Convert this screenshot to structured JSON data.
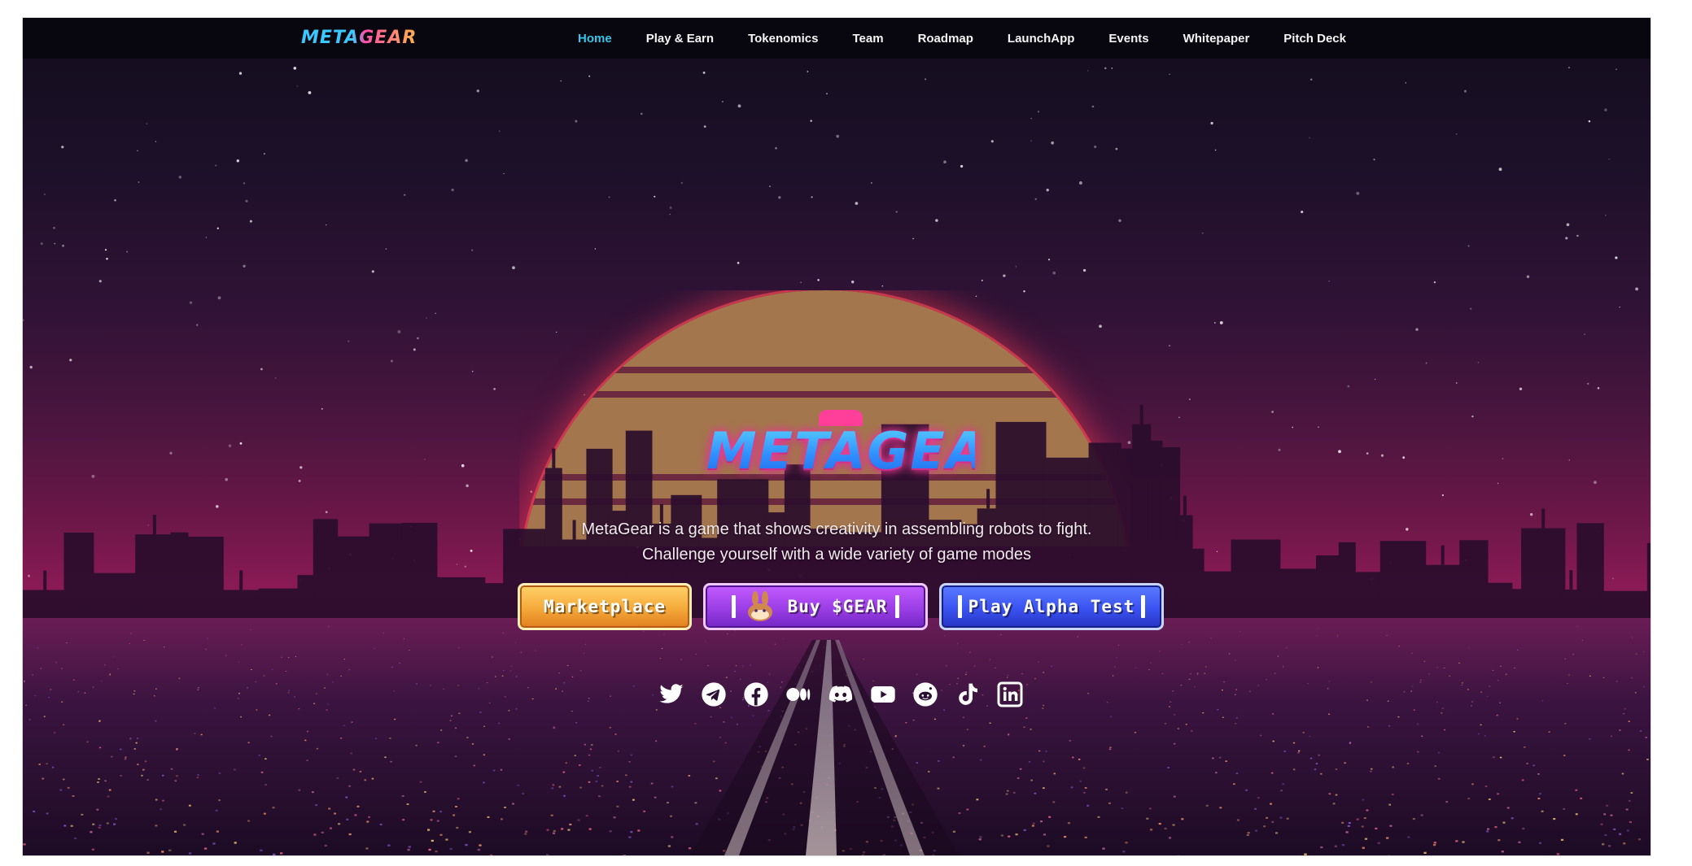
{
  "brand": {
    "name": "METAGEAR"
  },
  "nav": {
    "items": [
      {
        "label": "Home",
        "active": true
      },
      {
        "label": "Play & Earn",
        "active": false
      },
      {
        "label": "Tokenomics",
        "active": false
      },
      {
        "label": "Team",
        "active": false
      },
      {
        "label": "Roadmap",
        "active": false
      },
      {
        "label": "LaunchApp",
        "active": false
      },
      {
        "label": "Events",
        "active": false
      },
      {
        "label": "Whitepaper",
        "active": false
      },
      {
        "label": "Pitch Deck",
        "active": false
      }
    ]
  },
  "hero": {
    "logo": "METAGEAR",
    "tagline_line1": "MetaGear is a game that shows creativity in assembling robots to fight.",
    "tagline_line2": "Challenge yourself with a wide variety of game modes"
  },
  "buttons": {
    "marketplace": "Marketplace",
    "buy": "Buy $GEAR",
    "alpha": "Play Alpha Test"
  },
  "socials": [
    "twitter-icon",
    "telegram-icon",
    "facebook-icon",
    "medium-icon",
    "discord-icon",
    "youtube-icon",
    "reddit-icon",
    "tiktok-icon",
    "linkedin-icon"
  ],
  "colors": {
    "nav_active": "#35c6e8",
    "marketplace": "#f5a93a",
    "buy": "#9b3ee6",
    "alpha": "#3b52f2"
  }
}
